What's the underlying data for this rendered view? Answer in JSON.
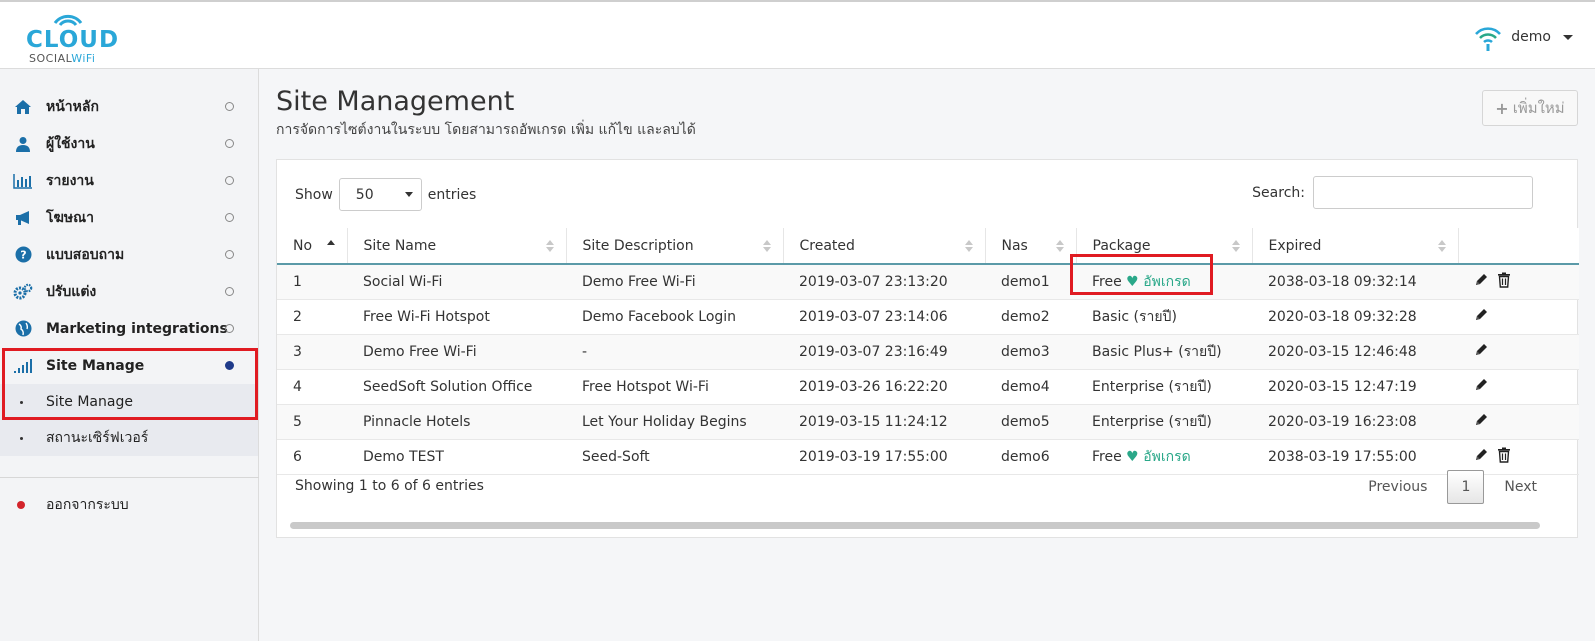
{
  "brand": {
    "name": "CLOUD",
    "sub_prefix": "SOCIAL",
    "sub_suffix": "WiFi"
  },
  "user": {
    "name": "demo"
  },
  "sidebar": {
    "items": [
      {
        "label": "หน้าหลัก",
        "icon": "home-icon"
      },
      {
        "label": "ผู้ใช้งาน",
        "icon": "user-icon"
      },
      {
        "label": "รายงาน",
        "icon": "bar-chart-icon"
      },
      {
        "label": "โฆษณา",
        "icon": "megaphone-icon"
      },
      {
        "label": "แบบสอบถาม",
        "icon": "question-circle-icon"
      },
      {
        "label": "ปรับแต่ง",
        "icon": "gears-icon"
      },
      {
        "label": "Marketing integrations",
        "icon": "globe-icon"
      },
      {
        "label": "Site Manage",
        "icon": "signal-icon"
      }
    ],
    "subitems": [
      "Site Manage",
      "สถานะเซิร์ฟเวอร์"
    ],
    "logout": "ออกจากระบบ"
  },
  "page": {
    "title": "Site Management",
    "subtitle": "การจัดการไซต์งานในระบบ โดยสามารถอัพเกรด เพิ่ม แก้ไข และลบได้",
    "add_button": "เพิ่มใหม่"
  },
  "table": {
    "show_label": "Show",
    "entries_label": "entries",
    "page_size": "50",
    "search_label": "Search:",
    "search_value": "",
    "columns": [
      "No",
      "Site Name",
      "Site Description",
      "Created",
      "Nas",
      "Package",
      "Expired"
    ],
    "rows": [
      {
        "no": "1",
        "name": "Social Wi-Fi",
        "desc": "Demo Free Wi-Fi",
        "created": "2019-03-07 23:13:20",
        "nas": "demo1",
        "package": "Free",
        "upgrade": "อัพเกรด",
        "expired": "2038-03-18 09:32:14",
        "deletable": true
      },
      {
        "no": "2",
        "name": "Free Wi-Fi Hotspot",
        "desc": "Demo Facebook Login",
        "created": "2019-03-07 23:14:06",
        "nas": "demo2",
        "package": "Basic (รายปี)",
        "upgrade": "",
        "expired": "2020-03-18 09:32:28",
        "deletable": false
      },
      {
        "no": "3",
        "name": "Demo Free Wi-Fi",
        "desc": "-",
        "created": "2019-03-07 23:16:49",
        "nas": "demo3",
        "package": "Basic Plus+ (รายปี)",
        "upgrade": "",
        "expired": "2020-03-15 12:46:48",
        "deletable": false
      },
      {
        "no": "4",
        "name": "SeedSoft Solution Office",
        "desc": "Free Hotspot Wi-Fi",
        "created": "2019-03-26 16:22:20",
        "nas": "demo4",
        "package": "Enterprise (รายปี)",
        "upgrade": "",
        "expired": "2020-03-15 12:47:19",
        "deletable": false
      },
      {
        "no": "5",
        "name": "Pinnacle Hotels",
        "desc": "Let Your Holiday Begins",
        "created": "2019-03-15 11:24:12",
        "nas": "demo5",
        "package": "Enterprise (รายปี)",
        "upgrade": "",
        "expired": "2020-03-19 16:23:08",
        "deletable": false
      },
      {
        "no": "6",
        "name": "Demo TEST",
        "desc": "Seed-Soft",
        "created": "2019-03-19 17:55:00",
        "nas": "demo6",
        "package": "Free",
        "upgrade": "อัพเกรด",
        "expired": "2038-03-19 17:55:00",
        "deletable": true
      }
    ],
    "info": "Showing 1 to 6 of 6 entries",
    "pager": {
      "prev": "Previous",
      "current": "1",
      "next": "Next"
    }
  },
  "colors": {
    "brand": "#2aa7d8",
    "accent_green": "#2aa889",
    "highlight_red": "#e01b22",
    "active_dot": "#1e3a8a"
  }
}
